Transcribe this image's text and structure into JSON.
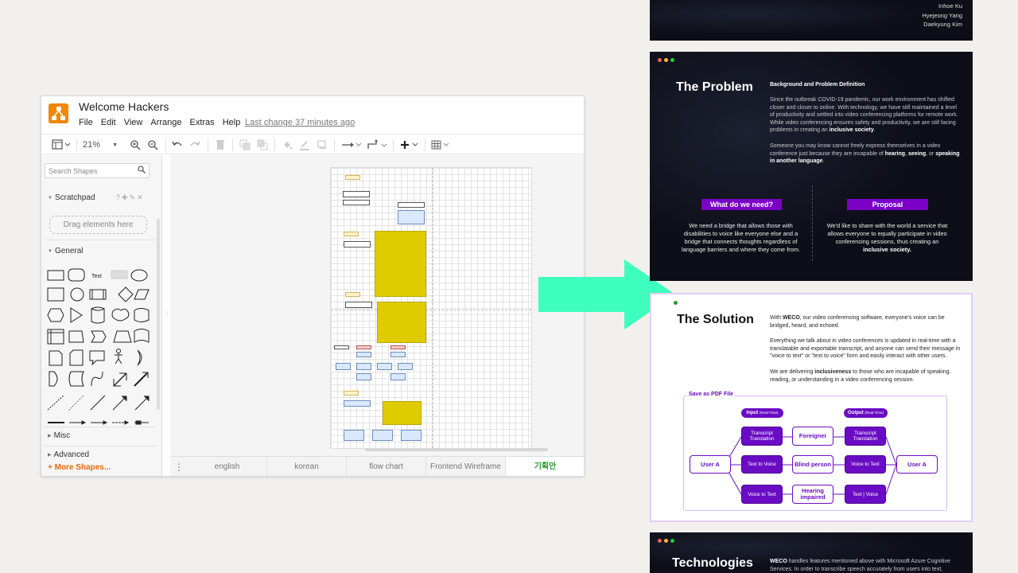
{
  "app": {
    "title": "Welcome Hackers",
    "menu": [
      "File",
      "Edit",
      "View",
      "Arrange",
      "Extras",
      "Help"
    ],
    "last_change": "Last change 37 minutes ago",
    "zoom": "21%",
    "icons": [
      "sidebar-toggle-icon",
      "zoom-in-icon",
      "zoom-out-icon",
      "undo-icon",
      "redo-icon",
      "delete-icon",
      "to-front-icon",
      "to-back-icon",
      "fill-color-icon",
      "line-color-icon",
      "shadow-icon",
      "connection-icon",
      "waypoints-icon",
      "insert-icon",
      "table-icon"
    ]
  },
  "sidebar": {
    "search_placeholder": "Search Shapes",
    "scratchpad": "Scratchpad",
    "drag_hint": "Drag elements here",
    "general": "General",
    "text_shape": "Text",
    "misc": "Misc",
    "advanced": "Advanced",
    "more_shapes": "+ More Shapes..."
  },
  "tabs": [
    "english",
    "korean",
    "flow chart",
    "Frontend Wireframe",
    "기획안"
  ],
  "active_tab": "기획안",
  "colors": {
    "accent": "#f08705",
    "purple": "#7a00c6",
    "arrow": "#3effbd",
    "tab_active": "#2a9b2a"
  },
  "slides": {
    "cover": {
      "names": [
        "Inhoe Ku",
        "Hyejeong Yang",
        "Daekyung Kim"
      ]
    },
    "problem": {
      "title": "The Problem",
      "subtitle": "Background and Problem Definition",
      "p1_a": "Since the outbreak COVID-19 pandemic, our work environment has shifted closer and closer to online. With technology, we have still maintained a level of productivity and settled into video conferencing platforms for remote work. While video conferencing ensures safety and productivity, we are still facing problems in creating an ",
      "p1_b": "inclusive society",
      "p1_c": ".",
      "p2_a": "Someone you may know cannot freely express themselves in a video conference just because they are incapable of ",
      "p2_b": "hearing",
      "p2_c": ", ",
      "p2_d": "seeing",
      "p2_e": ", or ",
      "p2_f": "speaking in another language",
      "p2_g": ".",
      "need_label": "What do we need?",
      "proposal_label": "Proposal",
      "need_text": "We need a bridge that allows those with disabilities to voice like everyone else and a bridge that connects thoughts regardless of language barriers and where they come from.",
      "proposal_text_a": "We'd like to share with the world a service that allows everyone to equally participate in video conferencing sessions, thus creating an ",
      "proposal_text_b": "inclusive society."
    },
    "solution": {
      "title": "The Solution",
      "p1_a": "With ",
      "p1_b": "WECO",
      "p1_c": ", our video conferencing software, everyone's voice can be bridged, heard, and echoed.",
      "p2": "Everything we talk about in video conferences is updated in real-time with a translatable and exportable transcript, and anyone can send their message in \"voice to text\" or \"text to voice\" form and easily interact with other users.",
      "p3_a": "We are delivering ",
      "p3_b": "inclusiveness",
      "p3_c": " to those who are incapable of speaking, reading, or understanding in a video conferencing session.",
      "diagram_label": "Save as PDF File",
      "input_label": "Input",
      "input_sub": "(Real-Time)",
      "output_label": "Output",
      "output_sub": "(Real-Time)",
      "user_a_left": "User A",
      "user_a_right": "User A",
      "transcript_left": "Transcript Translation",
      "transcript_right": "Transcript Translation",
      "text_to_voice_left": "Text to Voice",
      "voice_to_text_left": "Voice to Text",
      "voice_to_text_right": "Voice to Text",
      "text_voice_right": "Text | Voice",
      "foreigner": "Foreigner",
      "blind": "Blind person",
      "hearing": "Hearing impaired"
    },
    "technologies": {
      "title": "Technologies",
      "p1_a": "WECO",
      "p1_b": " handles features mentioned above with Microsoft Azure Cognitive Services. In order to transcribe speech accurately from users into text,"
    }
  }
}
